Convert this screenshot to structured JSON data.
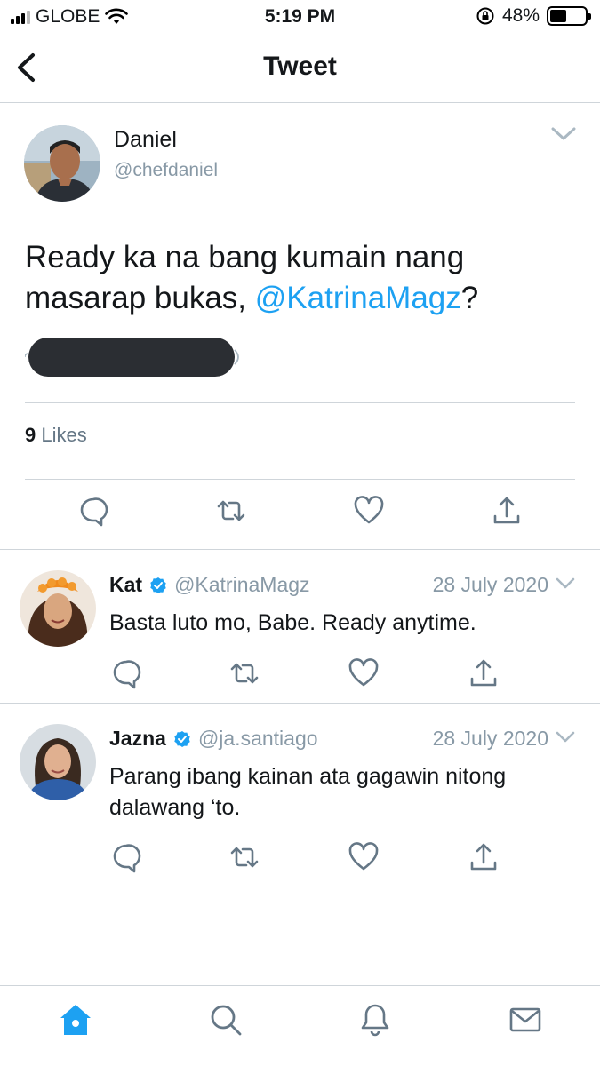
{
  "status_bar": {
    "carrier": "GLOBE",
    "time": "5:19 PM",
    "battery_percent": "48%",
    "battery_level": 0.48
  },
  "nav": {
    "title": "Tweet",
    "back_icon": "chevron-left-icon"
  },
  "tweet": {
    "author_name": "Daniel",
    "author_handle": "@chefdaniel",
    "text_before": "Ready ka na bang kumain nang masarap bukas, ",
    "mention": "@KatrinaMagz",
    "text_after": "?",
    "likes_count": "9",
    "likes_label": "Likes"
  },
  "replies": [
    {
      "name": "Kat",
      "verified": true,
      "handle": "@KatrinaMagz",
      "date": "28 July 2020",
      "text": "Basta luto mo, Babe. Ready anytime."
    },
    {
      "name": "Jazna",
      "verified": true,
      "handle": "@ja.santiago",
      "date": "28 July 2020",
      "text": "Parang ibang kainan ata gagawin nitong dalawang ‘to."
    }
  ],
  "tabs": [
    "home-icon",
    "search-icon",
    "notifications-bell-icon",
    "messages-mail-icon"
  ],
  "colors": {
    "accent": "#1da1f2",
    "icon_gray": "#657786",
    "divider": "#cfd5da",
    "verified": "#1da1f2"
  }
}
